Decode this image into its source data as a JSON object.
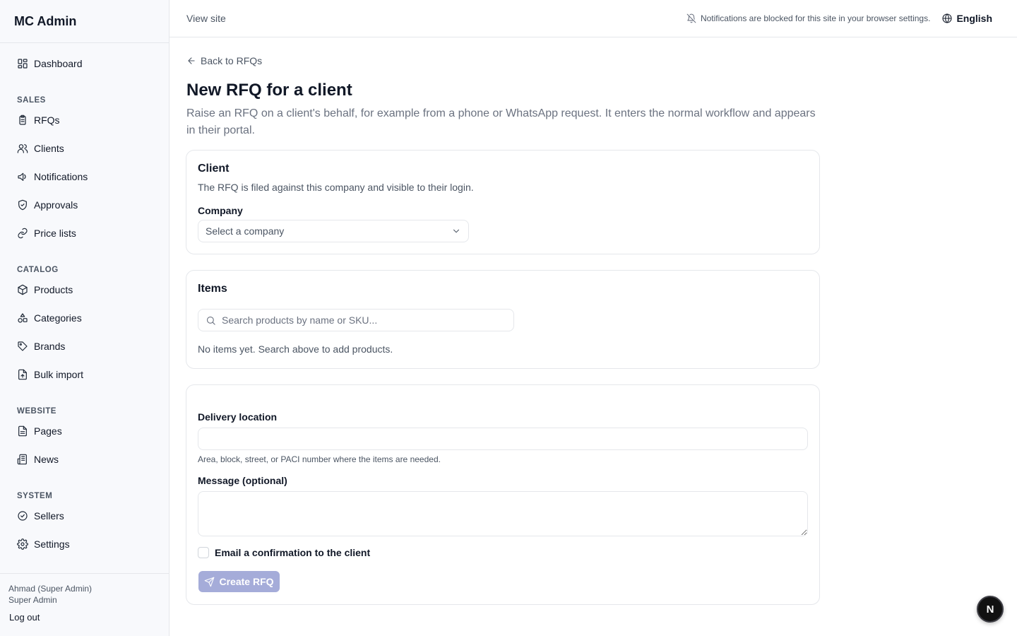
{
  "app": {
    "title": "MC Admin"
  },
  "sidebar": {
    "dashboard": {
      "label": "Dashboard",
      "icon": "dashboard-icon"
    },
    "sections": [
      {
        "label": "SALES",
        "items": [
          {
            "label": "RFQs",
            "icon": "clipboard-icon"
          },
          {
            "label": "Clients",
            "icon": "users-icon"
          },
          {
            "label": "Notifications",
            "icon": "megaphone-icon"
          },
          {
            "label": "Approvals",
            "icon": "shield-check-icon"
          },
          {
            "label": "Price lists",
            "icon": "link-icon"
          }
        ]
      },
      {
        "label": "CATALOG",
        "items": [
          {
            "label": "Products",
            "icon": "package-icon"
          },
          {
            "label": "Categories",
            "icon": "shapes-icon"
          },
          {
            "label": "Brands",
            "icon": "tag-icon"
          },
          {
            "label": "Bulk import",
            "icon": "file-upload-icon"
          }
        ]
      },
      {
        "label": "WEBSITE",
        "items": [
          {
            "label": "Pages",
            "icon": "file-text-icon"
          },
          {
            "label": "News",
            "icon": "newspaper-icon"
          }
        ]
      },
      {
        "label": "SYSTEM",
        "items": [
          {
            "label": "Sellers",
            "icon": "badge-check-icon"
          },
          {
            "label": "Settings",
            "icon": "gear-icon"
          }
        ]
      }
    ],
    "footer": {
      "user": "Ahmad (Super Admin)",
      "role": "Super Admin",
      "logout": "Log out"
    }
  },
  "topbar": {
    "view_site": "View site",
    "notifications_note": "Notifications are blocked for this site in your browser settings.",
    "language": "English"
  },
  "page": {
    "back": "Back to RFQs",
    "title": "New RFQ for a client",
    "description": "Raise an RFQ on a client's behalf, for example from a phone or WhatsApp request. It enters the normal workflow and appears in their portal."
  },
  "client_card": {
    "title": "Client",
    "subtitle": "The RFQ is filed against this company and visible to their login.",
    "company_label": "Company",
    "company_placeholder": "Select a company"
  },
  "items_card": {
    "title": "Items",
    "search_placeholder": "Search products by name or SKU...",
    "empty": "No items yet. Search above to add products."
  },
  "details_card": {
    "delivery_label": "Delivery location",
    "delivery_value": "",
    "delivery_help": "Area, block, street, or PACI number where the items are needed.",
    "message_label": "Message (optional)",
    "message_value": "",
    "email_confirm": "Email a confirmation to the client",
    "email_confirm_checked": false,
    "submit": "Create RFQ"
  },
  "fab": {
    "label": "N"
  },
  "colors": {
    "accent_disabled": "#a5acd9",
    "sidebar_bg": "#f8f9fc",
    "border": "#e5e7eb"
  }
}
